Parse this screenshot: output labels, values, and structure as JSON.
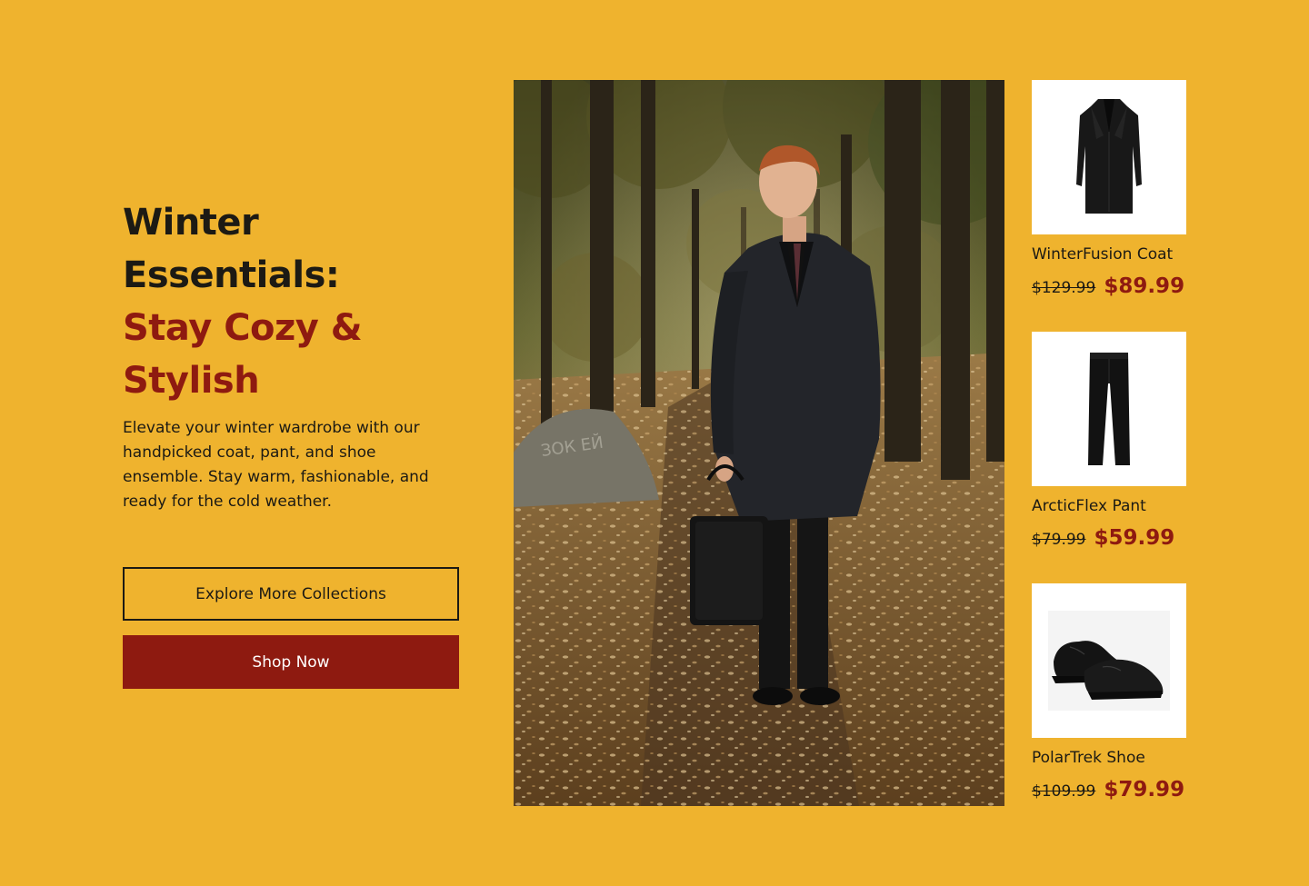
{
  "colors": {
    "background": "#EFB32E",
    "accent": "#8E1A10",
    "text": "#1C1A14",
    "card": "#FFFFFF"
  },
  "hero": {
    "title_line1": "Winter",
    "title_line2": "Essentials:",
    "title_line3": "Stay Cozy &",
    "title_line4": "Stylish",
    "description": "Elevate your winter wardrobe with our handpicked coat, pant, and shoe ensemble. Stay warm, fashionable, and ready for the cold weather."
  },
  "buttons": {
    "explore_label": "Explore More Collections",
    "shop_label": "Shop Now"
  },
  "main_image": {
    "alt": "Man in a black wool coat standing on a leaf-covered forest path holding a black tote bag"
  },
  "products": [
    {
      "name": "WinterFusion Coat",
      "old_price": "$129.99",
      "new_price": "$89.99",
      "icon": "coat-icon"
    },
    {
      "name": "ArcticFlex Pant",
      "old_price": "$79.99",
      "new_price": "$59.99",
      "icon": "pant-icon"
    },
    {
      "name": "PolarTrek Shoe",
      "old_price": "$109.99",
      "new_price": "$79.99",
      "icon": "shoe-icon"
    }
  ]
}
